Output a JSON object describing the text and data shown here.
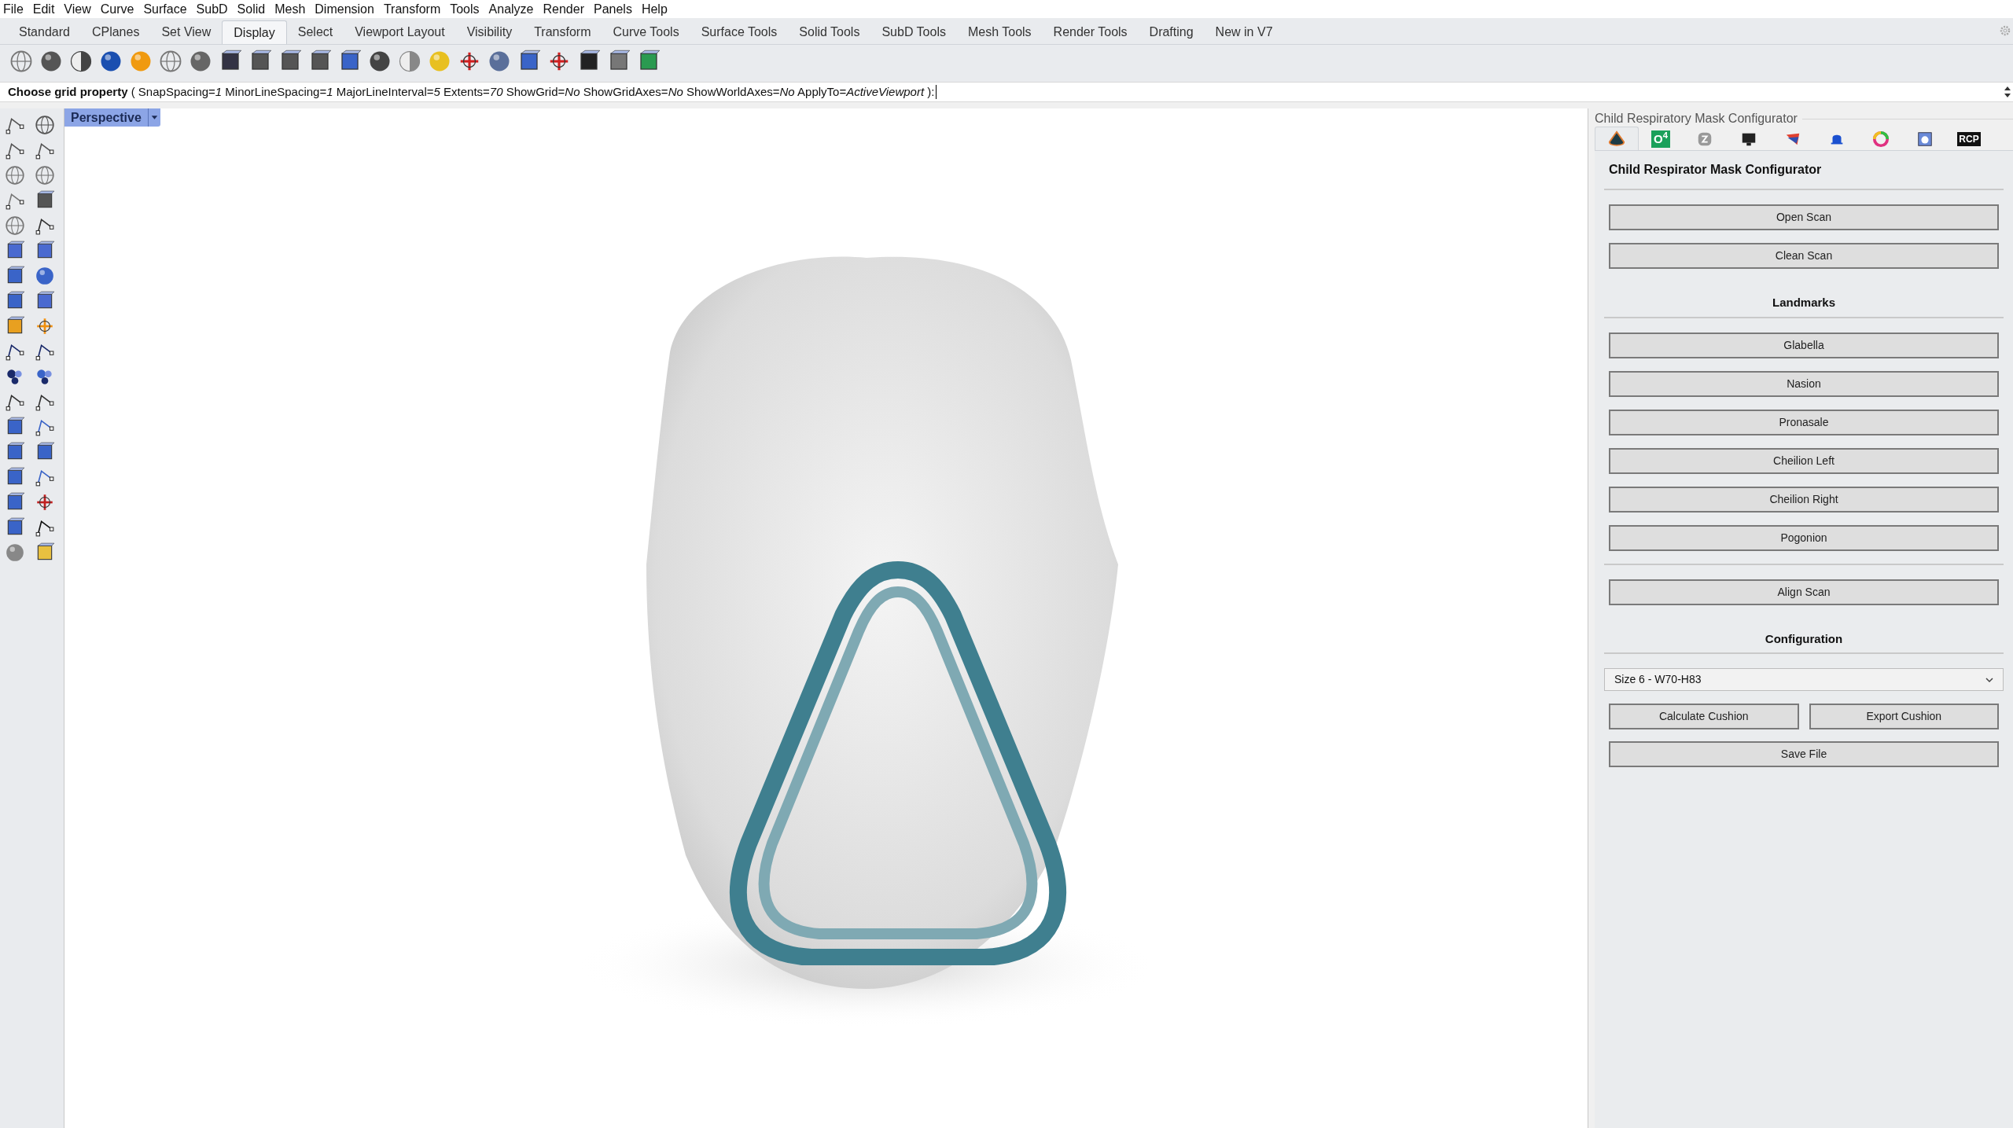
{
  "menu": [
    "File",
    "Edit",
    "View",
    "Curve",
    "Surface",
    "SubD",
    "Solid",
    "Mesh",
    "Dimension",
    "Transform",
    "Tools",
    "Analyze",
    "Render",
    "Panels",
    "Help"
  ],
  "toolbar_tabs": [
    {
      "label": "Standard",
      "selected": false
    },
    {
      "label": "CPlanes",
      "selected": false
    },
    {
      "label": "Set View",
      "selected": false
    },
    {
      "label": "Display",
      "selected": true
    },
    {
      "label": "Select",
      "selected": false
    },
    {
      "label": "Viewport Layout",
      "selected": false
    },
    {
      "label": "Visibility",
      "selected": false
    },
    {
      "label": "Transform",
      "selected": false
    },
    {
      "label": "Curve Tools",
      "selected": false
    },
    {
      "label": "Surface Tools",
      "selected": false
    },
    {
      "label": "Solid Tools",
      "selected": false
    },
    {
      "label": "SubD Tools",
      "selected": false
    },
    {
      "label": "Mesh Tools",
      "selected": false
    },
    {
      "label": "Render Tools",
      "selected": false
    },
    {
      "label": "Drafting",
      "selected": false
    },
    {
      "label": "New in V7",
      "selected": false
    }
  ],
  "command_line": {
    "prompt": "**Choose grid property** ( SnapSpacing=*1*  MinorLineSpacing=*1*  MajorLineInterval=*5*  Extents=*70*  ShowGrid=*No*  ShowGridAxes=*No*  ShowWorldAxes=*No*  ApplyTo=*ActiveViewport* ):"
  },
  "viewport": {
    "title": "Perspective"
  },
  "panel": {
    "title": "Child Respiratory Mask Configurator",
    "tabs": [
      {
        "selected": true
      },
      {
        "selected": false,
        "label": "O$^{4}$"
      },
      {
        "selected": false
      },
      {
        "selected": false
      },
      {
        "selected": false
      },
      {
        "selected": false
      },
      {
        "selected": false
      },
      {
        "selected": false
      },
      {
        "selected": false,
        "label": "RCP"
      }
    ],
    "items": [
      {
        "kind": "title",
        "label": "Child Respirator Mask Configurator"
      },
      {
        "kind": "divider"
      },
      {
        "kind": "button",
        "label": "Open Scan"
      },
      {
        "kind": "button",
        "label": "Clean Scan"
      },
      {
        "kind": "heading",
        "label": "Landmarks"
      },
      {
        "kind": "divider"
      },
      {
        "kind": "button",
        "label": "Glabella"
      },
      {
        "kind": "button",
        "label": "Nasion"
      },
      {
        "kind": "button",
        "label": "Pronasale"
      },
      {
        "kind": "button",
        "label": "Cheilion Left"
      },
      {
        "kind": "button",
        "label": "Cheilion Right"
      },
      {
        "kind": "button",
        "label": "Pogonion"
      },
      {
        "kind": "divider"
      },
      {
        "kind": "button",
        "label": "Align Scan"
      },
      {
        "kind": "heading",
        "label": "Configuration"
      },
      {
        "kind": "divider"
      },
      {
        "kind": "select",
        "value": "Size 6 - W70-H83"
      },
      {
        "kind": "button_row",
        "buttons": [
          "Calculate Cushion",
          "Export Cushion"
        ]
      },
      {
        "kind": "button",
        "label": "Save File"
      }
    ]
  }
}
